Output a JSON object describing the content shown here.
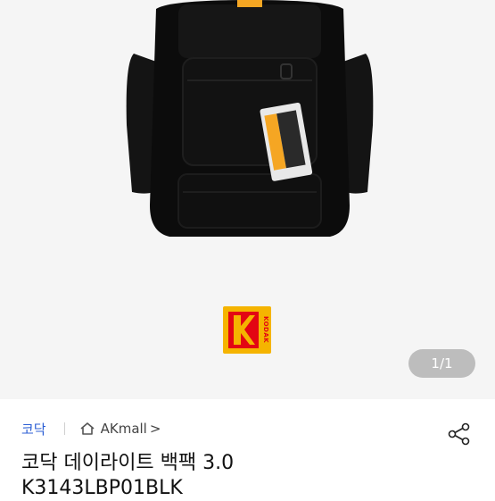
{
  "gallery": {
    "page_current": "1",
    "page_total": "1",
    "page_label": "1/1",
    "logo_text": "KODAK"
  },
  "product": {
    "brand": "코닥",
    "mall": "AKmall",
    "mall_chevron": ">",
    "title_line1": "코닥 데이라이트 백팩 3.0",
    "title_line2": "K3143LBP01BLK"
  },
  "icons": {
    "home": "home-icon",
    "share": "share-icon"
  },
  "colors": {
    "brand_link": "#2c5fd4",
    "kodak_yellow": "#f5b400",
    "kodak_red": "#e30613",
    "indicator_bg": "#bdbdbd"
  }
}
